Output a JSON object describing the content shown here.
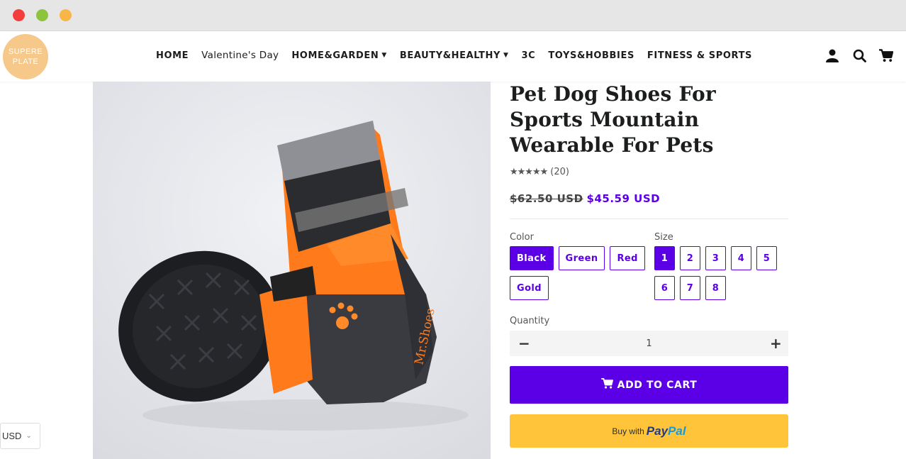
{
  "brand": {
    "logo_line1": "SUPERE",
    "logo_line2": "PLATE"
  },
  "nav": {
    "items": [
      {
        "label": "HOME"
      },
      {
        "label": "Valentine's Day"
      },
      {
        "label": "HOME&GARDEN"
      },
      {
        "label": "BEAUTY&HEALTHY"
      },
      {
        "label": "3C"
      },
      {
        "label": "TOYS&HOBBIES"
      },
      {
        "label": "FITNESS & SPORTS"
      }
    ]
  },
  "header_icons": [
    "account-icon",
    "search-icon",
    "cart-icon"
  ],
  "currency": {
    "value": "USD"
  },
  "product": {
    "title": "Pet Dog Shoes For Sports Mountain Wearable For Pets",
    "rating_count": "(20)",
    "rating_stars": 5,
    "price_old": "$62.50 USD",
    "price_new": "$45.59 USD",
    "color_label": "Color",
    "colors": [
      "Black",
      "Green",
      "Red",
      "Gold"
    ],
    "selected_color": "Black",
    "size_label": "Size",
    "sizes": [
      "1",
      "2",
      "3",
      "4",
      "5",
      "6",
      "7",
      "8"
    ],
    "selected_size": "1",
    "quantity_label": "Quantity",
    "quantity": "1",
    "qty_minus": "−",
    "qty_plus": "+",
    "add_to_cart": "ADD TO CART",
    "paypal_prefix": "Buy with",
    "paypal_brand1": "Pay",
    "paypal_brand2": "Pal",
    "image_brand_text": "Mr.Shoes"
  },
  "colors": {
    "accent": "#5b00e6",
    "paypal": "#ffc439",
    "shoe_orange": "#ff7a1a"
  }
}
